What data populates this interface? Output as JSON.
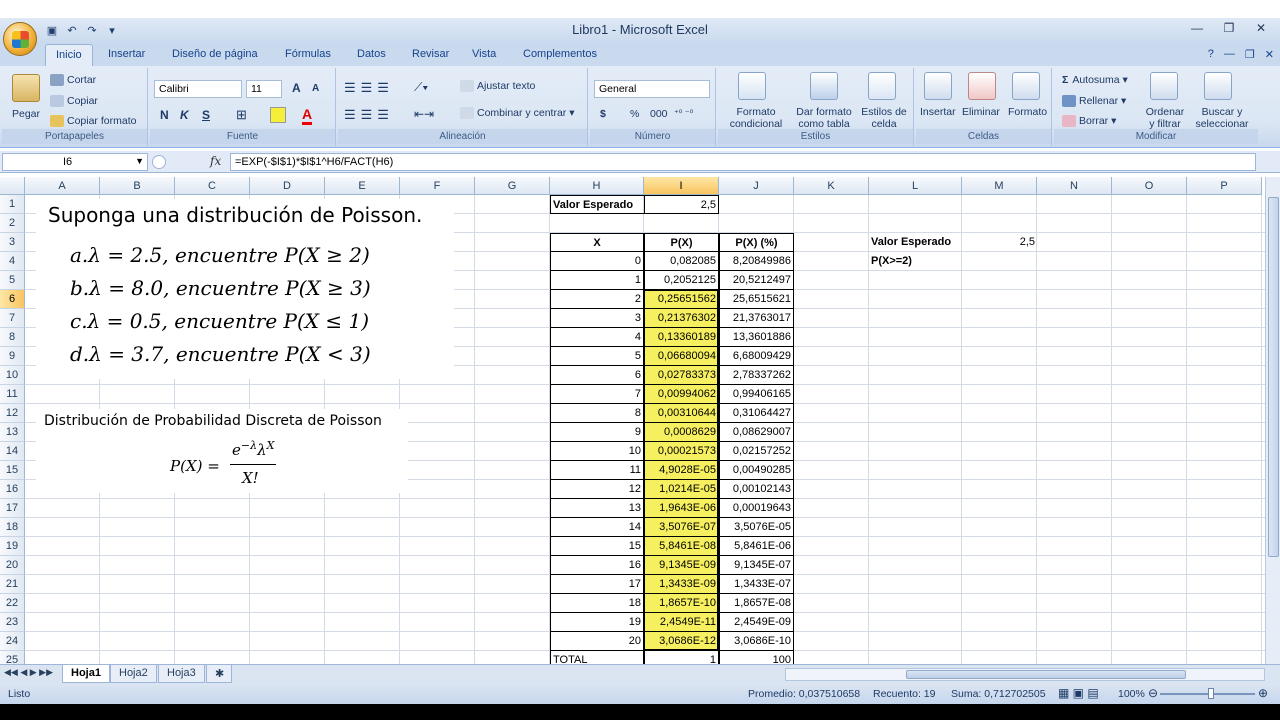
{
  "window": {
    "title": "Libro1 - Microsoft Excel"
  },
  "ribbon_tabs": [
    "Inicio",
    "Insertar",
    "Diseño de página",
    "Fórmulas",
    "Datos",
    "Revisar",
    "Vista",
    "Complementos"
  ],
  "ribbon": {
    "paste": "Pegar",
    "cut": "Cortar",
    "copy": "Copiar",
    "format_painter": "Copiar formato",
    "font_name": "Calibri",
    "font_size": "11",
    "bold": "N",
    "italic": "K",
    "underline": "S",
    "wrap_text": "Ajustar texto",
    "merge_center": "Combinar y centrar",
    "number_format": "General",
    "currency": "$",
    "percent": "%",
    "thousands": "000",
    "cond_format_1": "Formato",
    "cond_format_2": "condicional",
    "table_format_1": "Dar formato",
    "table_format_2": "como tabla",
    "cell_styles_1": "Estilos de",
    "cell_styles_2": "celda",
    "insert": "Insertar",
    "delete": "Eliminar",
    "format": "Formato",
    "autosum": "Autosuma",
    "fill": "Rellenar",
    "clear": "Borrar",
    "sort_1": "Ordenar",
    "sort_2": "y filtrar",
    "find_1": "Buscar y",
    "find_2": "seleccionar",
    "groups": {
      "clipboard": "Portapapeles",
      "font": "Fuente",
      "alignment": "Alineación",
      "number": "Número",
      "styles": "Estilos",
      "cells": "Celdas",
      "editing": "Modificar"
    }
  },
  "formula_bar": {
    "name_box": "I6",
    "fx": "fx",
    "formula": "=EXP(-$I$1)*$I$1^H6/FACT(H6)"
  },
  "columns": [
    "A",
    "B",
    "C",
    "D",
    "E",
    "F",
    "G",
    "H",
    "I",
    "J",
    "K",
    "L",
    "M",
    "N",
    "O",
    "P"
  ],
  "rows": [
    "1",
    "2",
    "3",
    "4",
    "5",
    "6",
    "7",
    "8",
    "9",
    "10",
    "11",
    "12",
    "13",
    "14",
    "15",
    "16",
    "17",
    "18",
    "19",
    "20",
    "21",
    "22",
    "23",
    "24",
    "25"
  ],
  "problem": {
    "heading": "Suponga una distribución de Poisson.",
    "items": [
      "a.λ = 2.5, encuentre P(X ≥ 2)",
      "b.λ = 8.0, encuentre P(X ≥ 3)",
      "c.λ = 0.5, encuentre P(X ≤ 1)",
      "d.λ = 3.7, encuentre P(X < 3)"
    ],
    "formula_title": "Distribución de Probabilidad Discreta de  Poisson",
    "formula_lhs": "P(X) =",
    "formula_num": "e",
    "formula_num_sup": "−λ",
    "formula_num_2": "λ",
    "formula_num_sup2": "X",
    "formula_den": "X!"
  },
  "table": {
    "expected_label": "Valor Esperado",
    "expected_value": "2,5",
    "headers": [
      "X",
      "P(X)",
      "P(X) (%)"
    ],
    "rows": [
      [
        "0",
        "0,082085",
        "8,20849986"
      ],
      [
        "1",
        "0,2052125",
        "20,5212497"
      ],
      [
        "2",
        "0,25651562",
        "25,6515621"
      ],
      [
        "3",
        "0,21376302",
        "21,3763017"
      ],
      [
        "4",
        "0,13360189",
        "13,3601886"
      ],
      [
        "5",
        "0,06680094",
        "6,68009429"
      ],
      [
        "6",
        "0,02783373",
        "2,78337262"
      ],
      [
        "7",
        "0,00994062",
        "0,99406165"
      ],
      [
        "8",
        "0,00310644",
        "0,31064427"
      ],
      [
        "9",
        "0,0008629",
        "0,08629007"
      ],
      [
        "10",
        "0,00021573",
        "0,02157252"
      ],
      [
        "11",
        "4,9028E-05",
        "0,00490285"
      ],
      [
        "12",
        "1,0214E-05",
        "0,00102143"
      ],
      [
        "13",
        "1,9643E-06",
        "0,00019643"
      ],
      [
        "14",
        "3,5076E-07",
        "3,5076E-05"
      ],
      [
        "15",
        "5,8461E-08",
        "5,8461E-06"
      ],
      [
        "16",
        "9,1345E-09",
        "9,1345E-07"
      ],
      [
        "17",
        "1,3433E-09",
        "1,3433E-07"
      ],
      [
        "18",
        "1,8657E-10",
        "1,8657E-08"
      ],
      [
        "19",
        "2,4549E-11",
        "2,4549E-09"
      ],
      [
        "20",
        "3,0686E-12",
        "3,0686E-10"
      ]
    ],
    "total_label": "TOTAL",
    "total_p": "1",
    "total_pct": "100"
  },
  "side": {
    "expected_label": "Valor Esperado",
    "expected_value": "2,5",
    "prob_label": "P(X>=2)"
  },
  "sheets": [
    "Hoja1",
    "Hoja2",
    "Hoja3"
  ],
  "status": {
    "ready": "Listo",
    "average": "Promedio: 0,037510658",
    "count": "Recuento: 19",
    "sum": "Suma: 0,712702505",
    "zoom": "100%"
  }
}
